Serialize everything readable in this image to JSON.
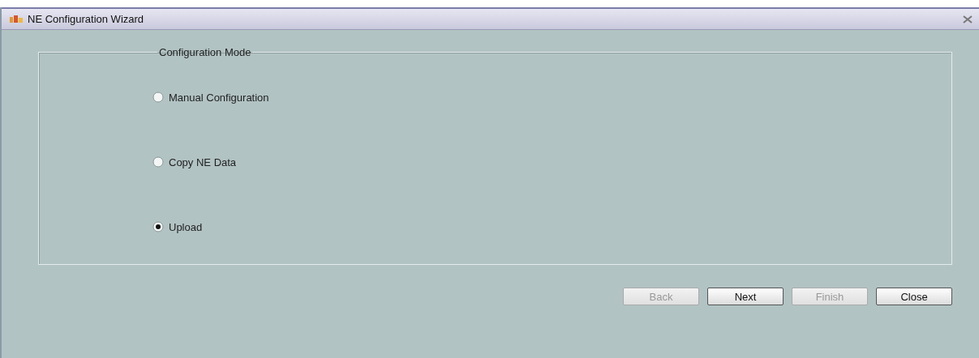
{
  "window": {
    "title": "NE Configuration Wizard"
  },
  "group": {
    "title": "Configuration Mode",
    "options": [
      {
        "label": "Manual Configuration",
        "selected": false
      },
      {
        "label": "Copy NE Data",
        "selected": false
      },
      {
        "label": "Upload",
        "selected": true
      }
    ]
  },
  "buttons": [
    {
      "label": "Back",
      "disabled": true
    },
    {
      "label": "Next",
      "disabled": false
    },
    {
      "label": "Finish",
      "disabled": true
    },
    {
      "label": "Close",
      "disabled": false
    }
  ]
}
